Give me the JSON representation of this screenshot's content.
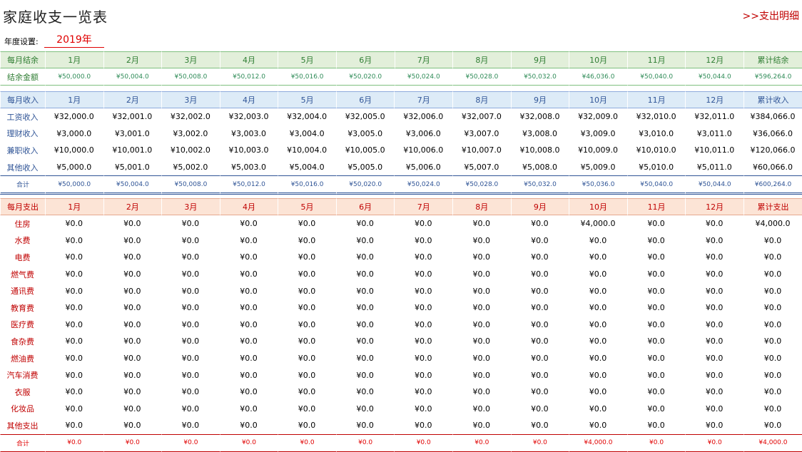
{
  "title": "家庭收支一览表",
  "expense_link": ">>支出明细",
  "year_label": "年度设置:",
  "year_value": "2019年",
  "months": [
    "1月",
    "2月",
    "3月",
    "4月",
    "5月",
    "6月",
    "7月",
    "8月",
    "9月",
    "10月",
    "11月",
    "12月"
  ],
  "balance": {
    "header_label": "每月结余",
    "total_header": "累计结余",
    "row_label": "结余金额",
    "values": [
      "¥50,000.0",
      "¥50,004.0",
      "¥50,008.0",
      "¥50,012.0",
      "¥50,016.0",
      "¥50,020.0",
      "¥50,024.0",
      "¥50,028.0",
      "¥50,032.0",
      "¥46,036.0",
      "¥50,040.0",
      "¥50,044.0",
      "¥596,264.0"
    ]
  },
  "income": {
    "header_label": "每月收入",
    "total_header": "累计收入",
    "rows": [
      {
        "label": "工资收入",
        "values": [
          "¥32,000.0",
          "¥32,001.0",
          "¥32,002.0",
          "¥32,003.0",
          "¥32,004.0",
          "¥32,005.0",
          "¥32,006.0",
          "¥32,007.0",
          "¥32,008.0",
          "¥32,009.0",
          "¥32,010.0",
          "¥32,011.0",
          "¥384,066.0"
        ]
      },
      {
        "label": "理财收入",
        "values": [
          "¥3,000.0",
          "¥3,001.0",
          "¥3,002.0",
          "¥3,003.0",
          "¥3,004.0",
          "¥3,005.0",
          "¥3,006.0",
          "¥3,007.0",
          "¥3,008.0",
          "¥3,009.0",
          "¥3,010.0",
          "¥3,011.0",
          "¥36,066.0"
        ]
      },
      {
        "label": "兼职收入",
        "values": [
          "¥10,000.0",
          "¥10,001.0",
          "¥10,002.0",
          "¥10,003.0",
          "¥10,004.0",
          "¥10,005.0",
          "¥10,006.0",
          "¥10,007.0",
          "¥10,008.0",
          "¥10,009.0",
          "¥10,010.0",
          "¥10,011.0",
          "¥120,066.0"
        ]
      },
      {
        "label": "其他收入",
        "values": [
          "¥5,000.0",
          "¥5,001.0",
          "¥5,002.0",
          "¥5,003.0",
          "¥5,004.0",
          "¥5,005.0",
          "¥5,006.0",
          "¥5,007.0",
          "¥5,008.0",
          "¥5,009.0",
          "¥5,010.0",
          "¥5,011.0",
          "¥60,066.0"
        ]
      }
    ],
    "total_label": "合计",
    "total_values": [
      "¥50,000.0",
      "¥50,004.0",
      "¥50,008.0",
      "¥50,012.0",
      "¥50,016.0",
      "¥50,020.0",
      "¥50,024.0",
      "¥50,028.0",
      "¥50,032.0",
      "¥50,036.0",
      "¥50,040.0",
      "¥50,044.0",
      "¥600,264.0"
    ]
  },
  "expense": {
    "header_label": "每月支出",
    "total_header": "累计支出",
    "rows": [
      {
        "label": "住房",
        "values": [
          "¥0.0",
          "¥0.0",
          "¥0.0",
          "¥0.0",
          "¥0.0",
          "¥0.0",
          "¥0.0",
          "¥0.0",
          "¥0.0",
          "¥4,000.0",
          "¥0.0",
          "¥0.0",
          "¥4,000.0"
        ]
      },
      {
        "label": "水费",
        "values": [
          "¥0.0",
          "¥0.0",
          "¥0.0",
          "¥0.0",
          "¥0.0",
          "¥0.0",
          "¥0.0",
          "¥0.0",
          "¥0.0",
          "¥0.0",
          "¥0.0",
          "¥0.0",
          "¥0.0"
        ]
      },
      {
        "label": "电费",
        "values": [
          "¥0.0",
          "¥0.0",
          "¥0.0",
          "¥0.0",
          "¥0.0",
          "¥0.0",
          "¥0.0",
          "¥0.0",
          "¥0.0",
          "¥0.0",
          "¥0.0",
          "¥0.0",
          "¥0.0"
        ]
      },
      {
        "label": "燃气费",
        "values": [
          "¥0.0",
          "¥0.0",
          "¥0.0",
          "¥0.0",
          "¥0.0",
          "¥0.0",
          "¥0.0",
          "¥0.0",
          "¥0.0",
          "¥0.0",
          "¥0.0",
          "¥0.0",
          "¥0.0"
        ]
      },
      {
        "label": "通讯费",
        "values": [
          "¥0.0",
          "¥0.0",
          "¥0.0",
          "¥0.0",
          "¥0.0",
          "¥0.0",
          "¥0.0",
          "¥0.0",
          "¥0.0",
          "¥0.0",
          "¥0.0",
          "¥0.0",
          "¥0.0"
        ]
      },
      {
        "label": "教育费",
        "values": [
          "¥0.0",
          "¥0.0",
          "¥0.0",
          "¥0.0",
          "¥0.0",
          "¥0.0",
          "¥0.0",
          "¥0.0",
          "¥0.0",
          "¥0.0",
          "¥0.0",
          "¥0.0",
          "¥0.0"
        ]
      },
      {
        "label": "医疗费",
        "values": [
          "¥0.0",
          "¥0.0",
          "¥0.0",
          "¥0.0",
          "¥0.0",
          "¥0.0",
          "¥0.0",
          "¥0.0",
          "¥0.0",
          "¥0.0",
          "¥0.0",
          "¥0.0",
          "¥0.0"
        ]
      },
      {
        "label": "食杂费",
        "values": [
          "¥0.0",
          "¥0.0",
          "¥0.0",
          "¥0.0",
          "¥0.0",
          "¥0.0",
          "¥0.0",
          "¥0.0",
          "¥0.0",
          "¥0.0",
          "¥0.0",
          "¥0.0",
          "¥0.0"
        ]
      },
      {
        "label": "燃油费",
        "values": [
          "¥0.0",
          "¥0.0",
          "¥0.0",
          "¥0.0",
          "¥0.0",
          "¥0.0",
          "¥0.0",
          "¥0.0",
          "¥0.0",
          "¥0.0",
          "¥0.0",
          "¥0.0",
          "¥0.0"
        ]
      },
      {
        "label": "汽车消费",
        "values": [
          "¥0.0",
          "¥0.0",
          "¥0.0",
          "¥0.0",
          "¥0.0",
          "¥0.0",
          "¥0.0",
          "¥0.0",
          "¥0.0",
          "¥0.0",
          "¥0.0",
          "¥0.0",
          "¥0.0"
        ]
      },
      {
        "label": "衣服",
        "values": [
          "¥0.0",
          "¥0.0",
          "¥0.0",
          "¥0.0",
          "¥0.0",
          "¥0.0",
          "¥0.0",
          "¥0.0",
          "¥0.0",
          "¥0.0",
          "¥0.0",
          "¥0.0",
          "¥0.0"
        ]
      },
      {
        "label": "化妆品",
        "values": [
          "¥0.0",
          "¥0.0",
          "¥0.0",
          "¥0.0",
          "¥0.0",
          "¥0.0",
          "¥0.0",
          "¥0.0",
          "¥0.0",
          "¥0.0",
          "¥0.0",
          "¥0.0",
          "¥0.0"
        ]
      },
      {
        "label": "其他支出",
        "values": [
          "¥0.0",
          "¥0.0",
          "¥0.0",
          "¥0.0",
          "¥0.0",
          "¥0.0",
          "¥0.0",
          "¥0.0",
          "¥0.0",
          "¥0.0",
          "¥0.0",
          "¥0.0",
          "¥0.0"
        ]
      }
    ],
    "total_label": "合计",
    "total_values": [
      "¥0.0",
      "¥0.0",
      "¥0.0",
      "¥0.0",
      "¥0.0",
      "¥0.0",
      "¥0.0",
      "¥0.0",
      "¥0.0",
      "¥4,000.0",
      "¥0.0",
      "¥0.0",
      "¥4,000.0"
    ]
  }
}
